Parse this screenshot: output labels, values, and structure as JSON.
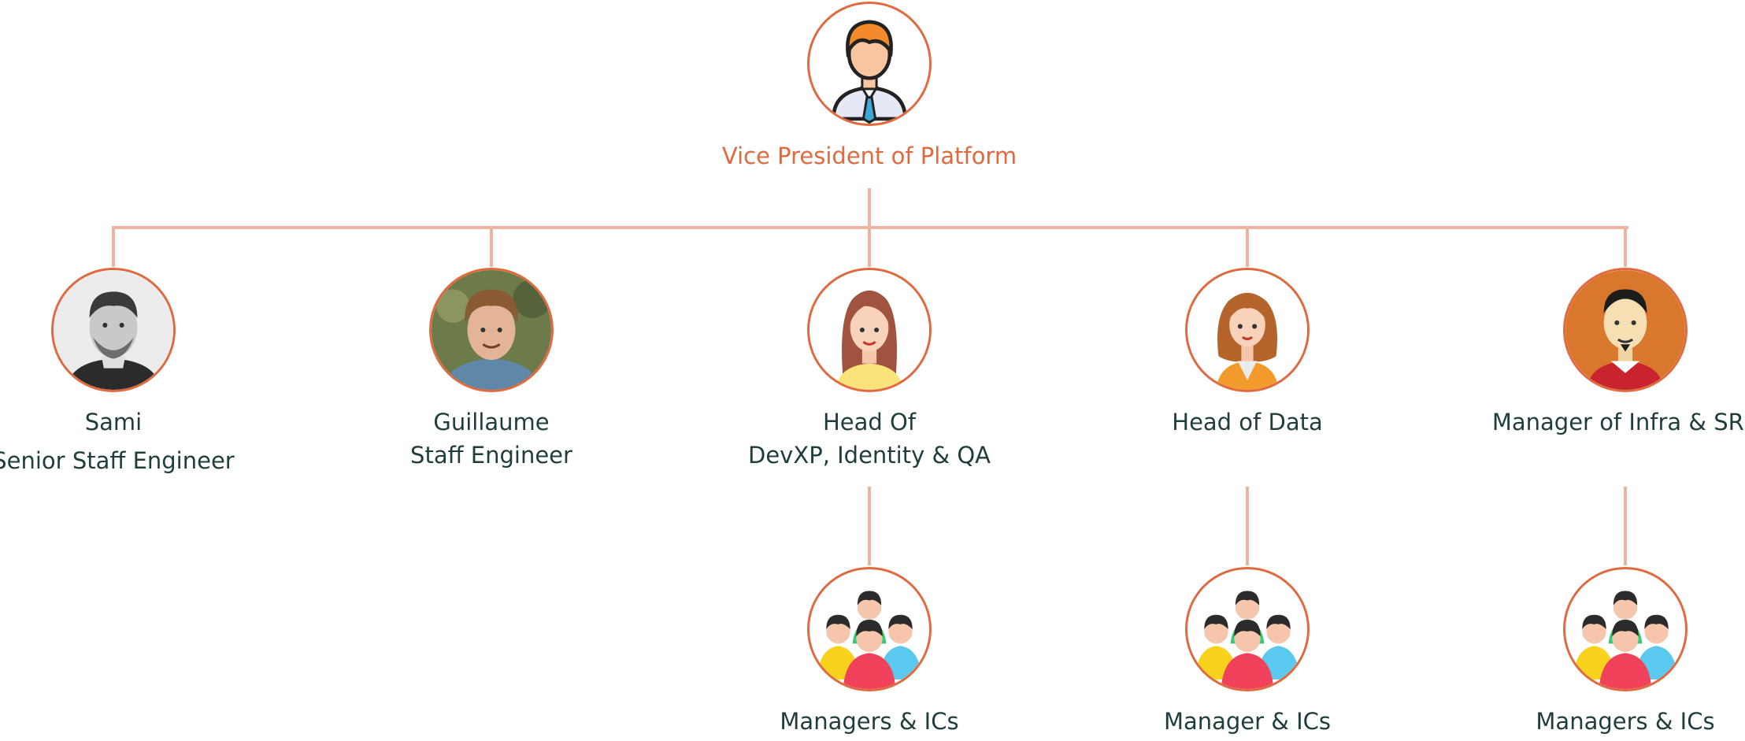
{
  "org_chart": {
    "root": {
      "icon": "business-man-icon",
      "title": "Vice President of Platform"
    },
    "reports": [
      {
        "icon": "photo-portrait-icon",
        "name": "Sami",
        "title": "Senior Staff Engineer"
      },
      {
        "icon": "photo-portrait-icon",
        "name": "Guillaume",
        "title": "Staff Engineer"
      },
      {
        "icon": "woman-avatar-icon",
        "name": "Head Of",
        "title": "DevXP, Identity & QA",
        "team": {
          "icon": "team-group-icon",
          "label": "Managers & ICs"
        }
      },
      {
        "icon": "woman-avatar-icon",
        "name": "Head of Data",
        "team": {
          "icon": "team-group-icon",
          "label": "Manager & ICs"
        }
      },
      {
        "icon": "man-avatar-icon",
        "name": "Manager of Infra & SRE",
        "team": {
          "icon": "team-group-icon",
          "label": "Managers & ICs"
        }
      }
    ]
  },
  "colors": {
    "accent": "#e06a3f",
    "connector": "#ecb6a3",
    "text": "#1f3d3d"
  }
}
